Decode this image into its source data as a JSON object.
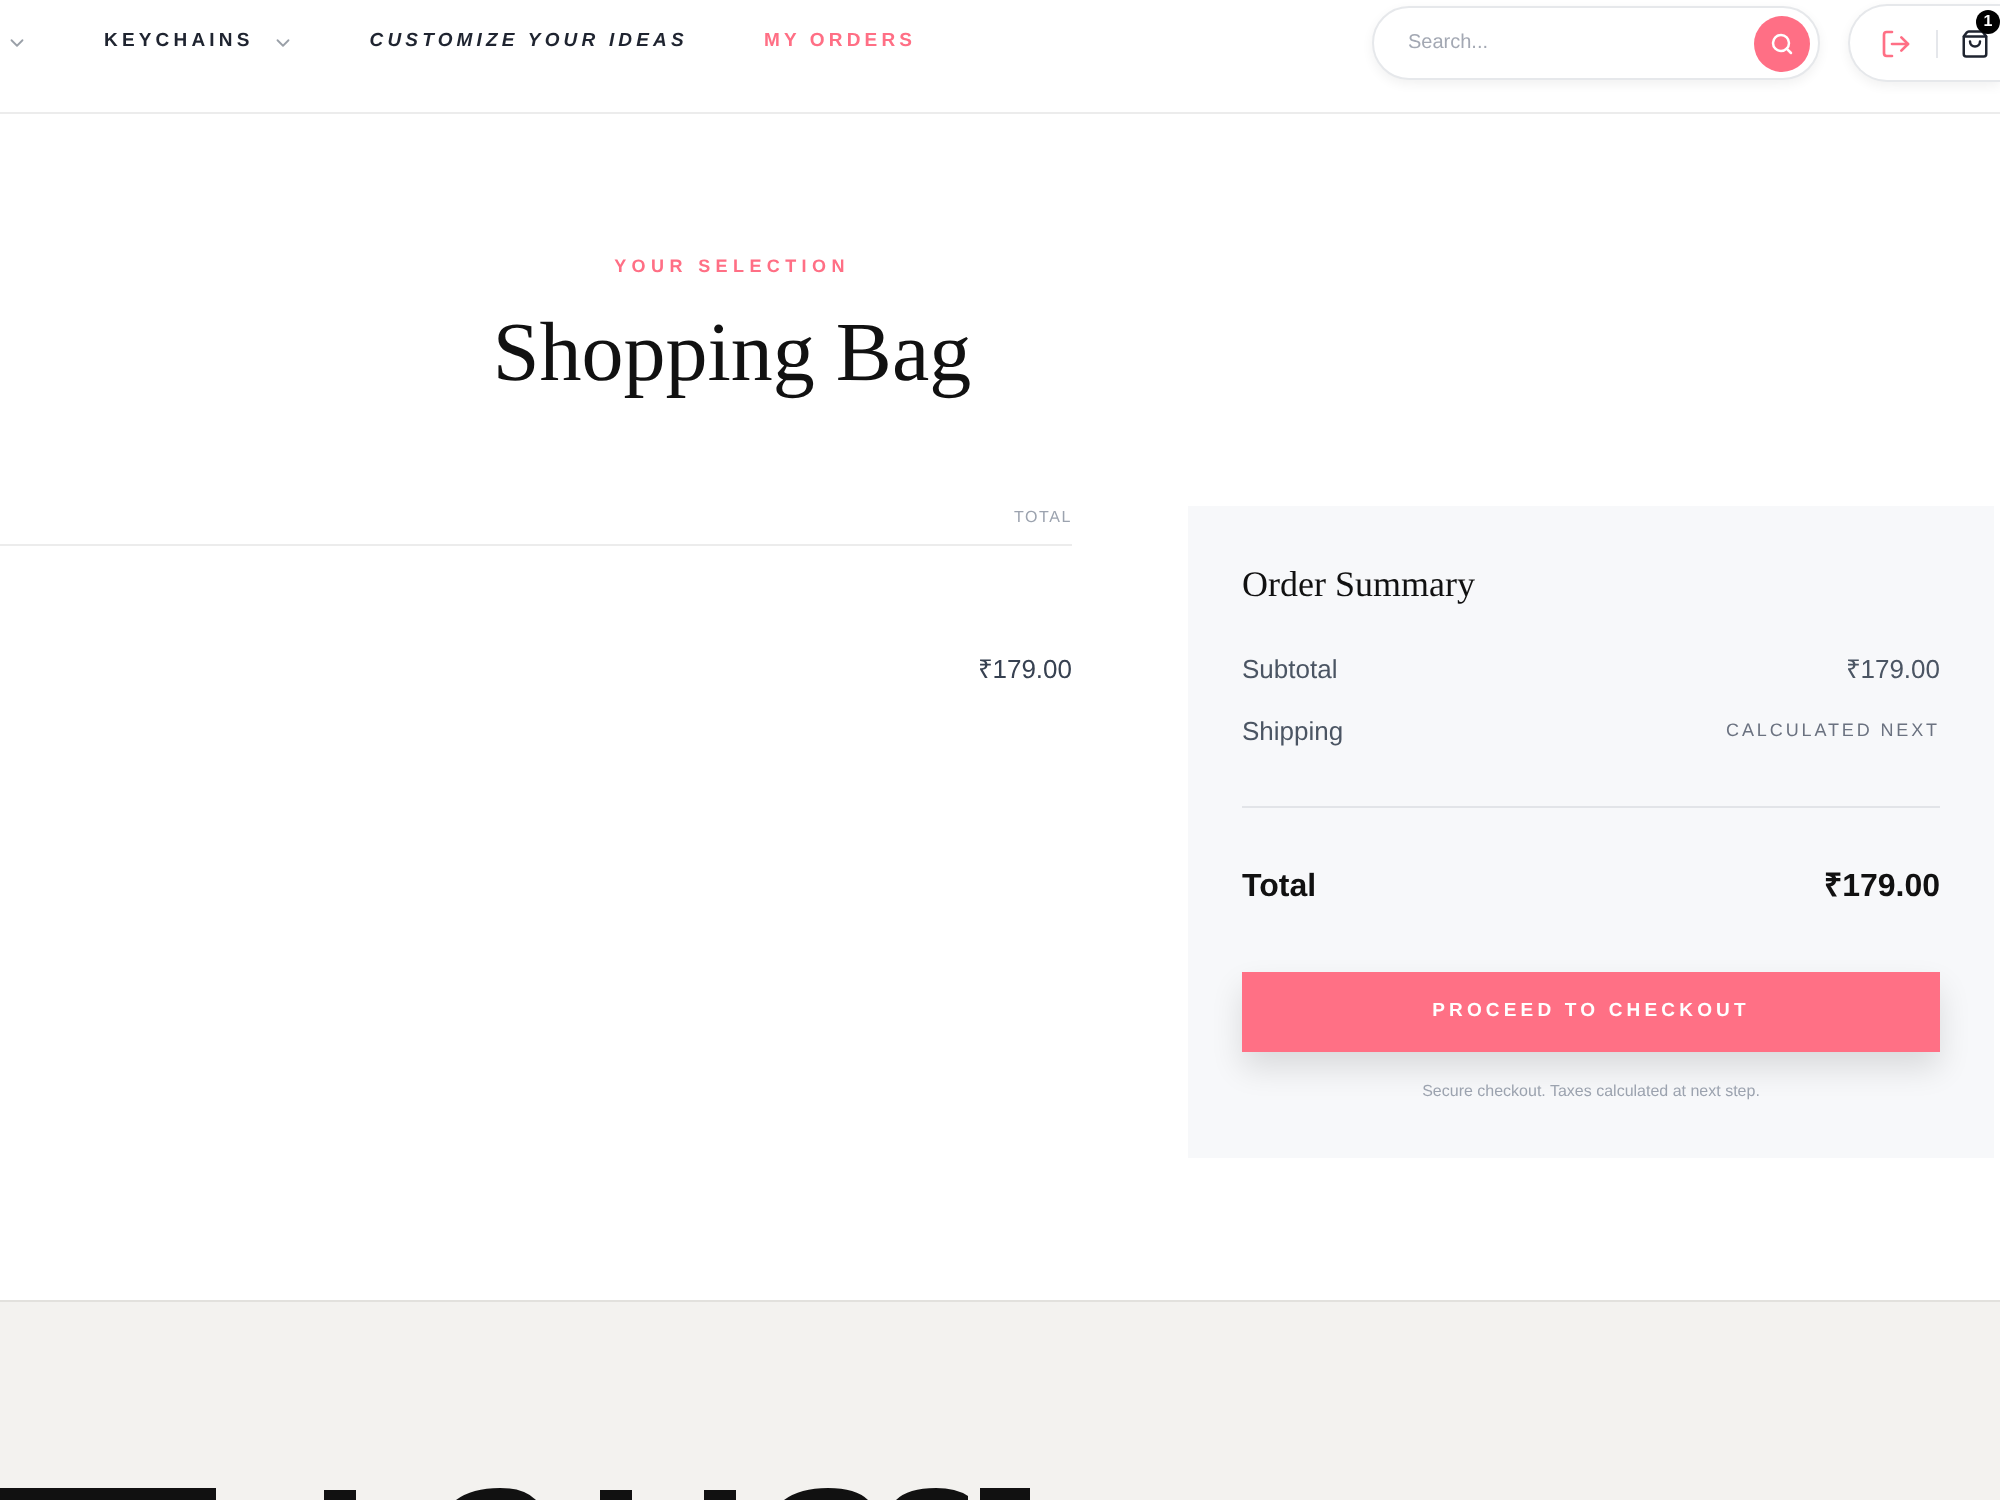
{
  "nav": {
    "items": [
      {
        "kind": "dropdown"
      },
      {
        "label": "KEYCHAINS",
        "kind": "dropdown"
      },
      {
        "label": "CUSTOMIZE YOUR IDEAS",
        "kind": "featured"
      },
      {
        "label": "MY ORDERS",
        "kind": "accent"
      }
    ]
  },
  "search": {
    "placeholder": "Search..."
  },
  "cart": {
    "count": "1"
  },
  "page": {
    "eyebrow": "YOUR SELECTION",
    "title": "Shopping Bag"
  },
  "bag_table": {
    "columns": [
      {
        "label": "TOTAL"
      }
    ],
    "rows": [
      {
        "total": "₹179.00"
      }
    ]
  },
  "order_summary": {
    "title": "Order Summary",
    "rows": [
      {
        "label": "Subtotal",
        "value": "₹179.00",
        "kind": "amount"
      },
      {
        "label": "Shipping",
        "value": "CALCULATED NEXT",
        "kind": "note"
      }
    ],
    "total": {
      "label": "Total",
      "value": "₹179.00"
    },
    "button": "PROCEED TO CHECKOUT",
    "note": "Secure checkout. Taxes calculated at next step."
  }
}
